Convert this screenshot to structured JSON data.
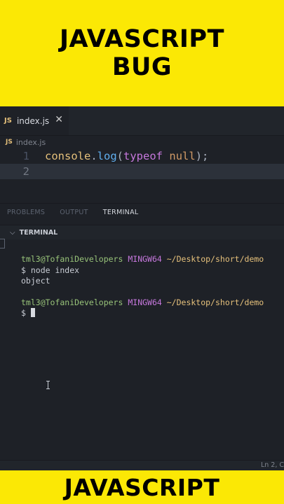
{
  "banner_top": {
    "line1": "JAVASCRIPT",
    "line2": "BUG"
  },
  "banner_bottom": {
    "label": "JAVASCRIPT"
  },
  "editor": {
    "tab": {
      "icon_label": "JS",
      "name": "index.js",
      "close": "✕"
    },
    "breadcrumb": {
      "icon_label": "JS",
      "name": "index.js"
    },
    "lines": [
      {
        "number": "1",
        "tokens": [
          "console",
          ".",
          "log",
          "(",
          "typeof",
          " ",
          "null",
          ");"
        ]
      },
      {
        "number": "2"
      }
    ]
  },
  "panel": {
    "tabs": [
      "PROBLEMS",
      "OUTPUT",
      "TERMINAL"
    ],
    "header": "TERMINAL",
    "terminal": {
      "prompt1": {
        "user": "tml3@TofaniDevelopers",
        "system": "MINGW64",
        "path": "~/Desktop/short/demo"
      },
      "command": "$ node index",
      "output": "object",
      "prompt2": {
        "user": "tml3@TofaniDevelopers",
        "system": "MINGW64",
        "path": "~/Desktop/short/demo"
      },
      "input_prompt": "$ "
    }
  },
  "status": {
    "position": "Ln 2, C"
  },
  "colors": {
    "banner": "#fbe805",
    "editor_bg": "#1e2127",
    "user": "#98c379",
    "mingw": "#c678dd",
    "path": "#e5c07b",
    "keyword": "#c678dd",
    "function": "#61afef",
    "null": "#d19a66"
  },
  "icons": [
    "js-icon",
    "close-icon",
    "chevron-down-icon",
    "text-cursor-icon"
  ]
}
